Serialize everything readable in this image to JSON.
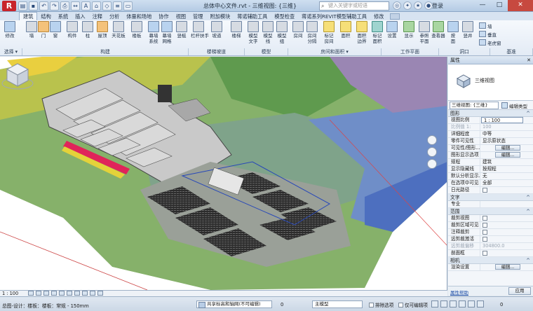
{
  "app": {
    "logo": "R",
    "title": "总体中心文件.rvt - 三维视图: {三维}",
    "search_placeholder": "键入关键字或短语",
    "login": "登录"
  },
  "qat_icons": [
    "open-icon",
    "save-icon",
    "undo-icon",
    "redo-icon",
    "print-icon",
    "measure-icon",
    "text-icon",
    "3d-view-icon",
    "section-icon",
    "thin-lines-icon",
    "close-hidden-icon"
  ],
  "window_buttons": {
    "minimize": "—",
    "maximize": "□",
    "close": "✕"
  },
  "tabs": [
    "建筑",
    "结构",
    "系统",
    "插入",
    "注释",
    "分析",
    "体量和场地",
    "协作",
    "视图",
    "管理",
    "附加模块",
    "蒋诺辅助工具",
    "模型检查",
    "蒋诺系列REVIT模型辅助工具",
    "修改"
  ],
  "active_tab": "建筑",
  "ribbon": {
    "buttons": [
      {
        "label": "修改",
        "icon": "modify-icon"
      },
      {
        "label": "墙",
        "icon": "wall-icon"
      },
      {
        "label": "门",
        "icon": "door-icon"
      },
      {
        "label": "窗",
        "icon": "window-icon"
      },
      {
        "label": "构件",
        "icon": "component-icon"
      },
      {
        "label": "柱",
        "icon": "column-icon"
      },
      {
        "label": "屋顶",
        "icon": "roof-icon"
      },
      {
        "label": "天花板",
        "icon": "ceiling-icon"
      },
      {
        "label": "楼板",
        "icon": "floor-icon"
      },
      {
        "label": "幕墙\n系统",
        "icon": "curtain-system-icon"
      },
      {
        "label": "幕墙\n网格",
        "icon": "curtain-grid-icon"
      },
      {
        "label": "竖梃",
        "icon": "mullion-icon"
      },
      {
        "label": "栏杆扶手",
        "icon": "railing-icon"
      },
      {
        "label": "坡道",
        "icon": "ramp-icon"
      },
      {
        "label": "楼梯",
        "icon": "stair-icon"
      },
      {
        "label": "模型\n文字",
        "icon": "model-text-icon"
      },
      {
        "label": "模型\n线",
        "icon": "model-line-icon"
      },
      {
        "label": "模型\n组",
        "icon": "model-group-icon"
      },
      {
        "label": "房间",
        "icon": "room-icon"
      },
      {
        "label": "房间\n分隔",
        "icon": "room-separator-icon"
      },
      {
        "label": "标记\n房间",
        "icon": "tag-room-icon"
      },
      {
        "label": "面积",
        "icon": "area-icon"
      },
      {
        "label": "面积\n边界",
        "icon": "area-boundary-icon"
      },
      {
        "label": "标记\n面积",
        "icon": "tag-area-icon"
      },
      {
        "label": "设置",
        "icon": "set-icon"
      },
      {
        "label": "显示",
        "icon": "show-icon"
      },
      {
        "label": "参照\n平面",
        "icon": "ref-plane-icon"
      },
      {
        "label": "查看器",
        "icon": "viewer-icon"
      },
      {
        "label": "按\n面",
        "icon": "by-face-icon"
      },
      {
        "label": "竖井",
        "icon": "shaft-icon"
      }
    ],
    "small_items": [
      "墙",
      "垂直",
      "老虎窗"
    ],
    "groups": [
      "选择 ▾",
      "构建",
      "楼梯坡道",
      "模型",
      "房间和面积 ▾",
      "工作平面",
      "洞口",
      "基准"
    ]
  },
  "viewport": {
    "view_name": "三维视图: {三维}",
    "viewcube_label": "前"
  },
  "properties": {
    "title": "属性",
    "type_name": "三维视图",
    "instance_selector": "三维视图: {三维}",
    "edit_type": "编辑类型",
    "sections": [
      {
        "name": "图形",
        "rows": [
          {
            "key": "视图比例",
            "value": "1 : 100",
            "style": "boxed"
          },
          {
            "key": "比例值 1:",
            "value": "100",
            "style": "dim"
          },
          {
            "key": "详细程度",
            "value": "中等"
          },
          {
            "key": "零件可见性",
            "value": "显示原状态"
          },
          {
            "key": "可见性/图形...",
            "value": "编辑...",
            "style": "btn"
          },
          {
            "key": "图形显示选项",
            "value": "编辑...",
            "style": "btn"
          },
          {
            "key": "规程",
            "value": "建筑"
          },
          {
            "key": "显示隐藏线",
            "value": "按规程"
          },
          {
            "key": "默认分析显示...",
            "value": "无"
          },
          {
            "key": "在选项中可见",
            "value": "全部"
          },
          {
            "key": "日光路径",
            "value": "",
            "style": "check"
          }
        ]
      },
      {
        "name": "文字",
        "rows": [
          {
            "key": "专业",
            "value": ""
          }
        ]
      },
      {
        "name": "范围",
        "rows": [
          {
            "key": "裁剪视图",
            "value": "",
            "style": "check"
          },
          {
            "key": "裁剪区域可见",
            "value": "",
            "style": "check"
          },
          {
            "key": "注释裁剪",
            "value": "",
            "style": "check"
          },
          {
            "key": "远剪裁激活",
            "value": "",
            "style": "check"
          },
          {
            "key": "远剪裁偏移",
            "value": "304800.0",
            "style": "dimboth"
          },
          {
            "key": "剖面框",
            "value": "",
            "style": "check"
          }
        ]
      },
      {
        "name": "相机",
        "rows": [
          {
            "key": "渲染设置",
            "value": "编辑...",
            "style": "btn"
          }
        ]
      }
    ],
    "help_link": "属性帮助",
    "apply": "应用"
  },
  "view_control": {
    "scale": "1 : 100"
  },
  "status": {
    "hint": "总图-设计：楼板：楼板：常规 - 150mm",
    "workset": "共享标高和轴网(不可编辑)",
    "num": "0",
    "model": "主模型",
    "exclude_options": "排除选项",
    "editable_only": "仅可编辑项",
    "filter_count": "0"
  },
  "colors": {
    "ribbon_bg": "#e8eff7",
    "accent": "#2b5797",
    "terrain_green": "#6fa357",
    "terrain_blue": "#6c8fc4"
  }
}
